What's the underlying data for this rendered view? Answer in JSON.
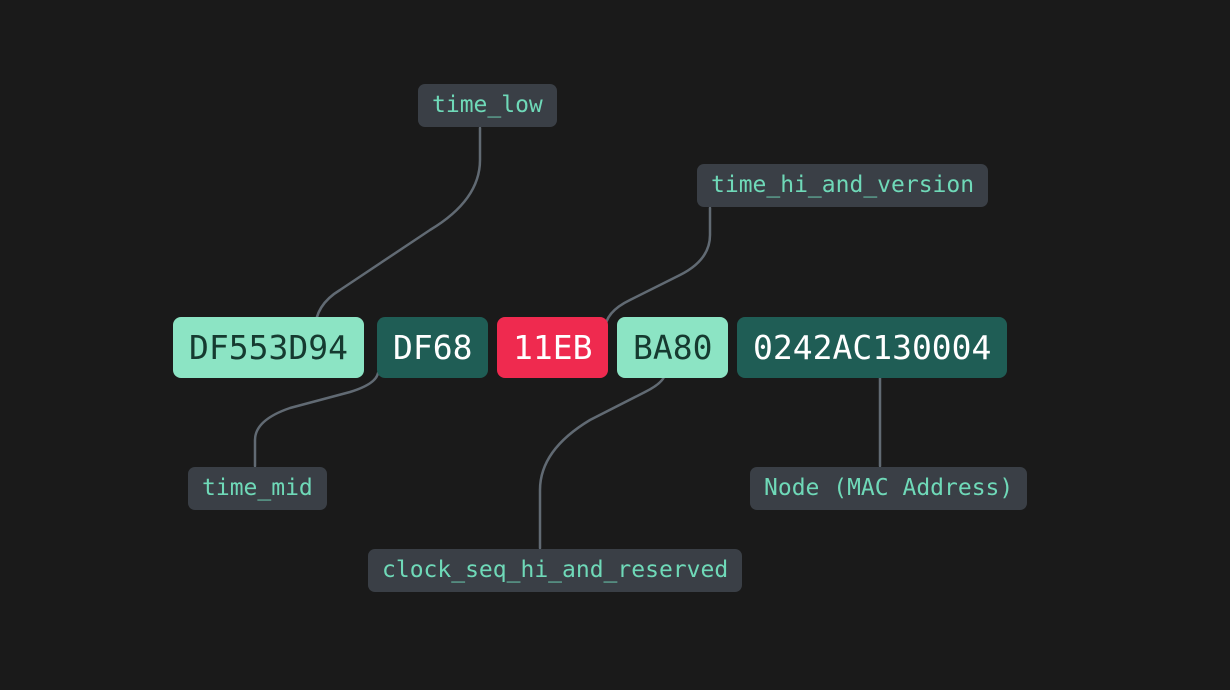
{
  "segments": {
    "time_low": "DF553D94",
    "time_mid": "DF68",
    "time_hi_and_version": "11EB",
    "clock_seq_hi_and_reserved": "BA80",
    "node": "0242AC130004"
  },
  "labels": {
    "time_low": "time_low",
    "time_mid": "time_mid",
    "time_hi_and_version": "time_hi_and_version",
    "clock_seq": "clock_seq_hi_and_reserved",
    "node": "Node (MAC Address)"
  },
  "colors": {
    "mint": "#8ce4c4",
    "teal": "#1f5d55",
    "red": "#ef2a4f",
    "label_bg": "#3a3f46",
    "label_fg": "#6fd9b8",
    "connector": "#616a73"
  }
}
